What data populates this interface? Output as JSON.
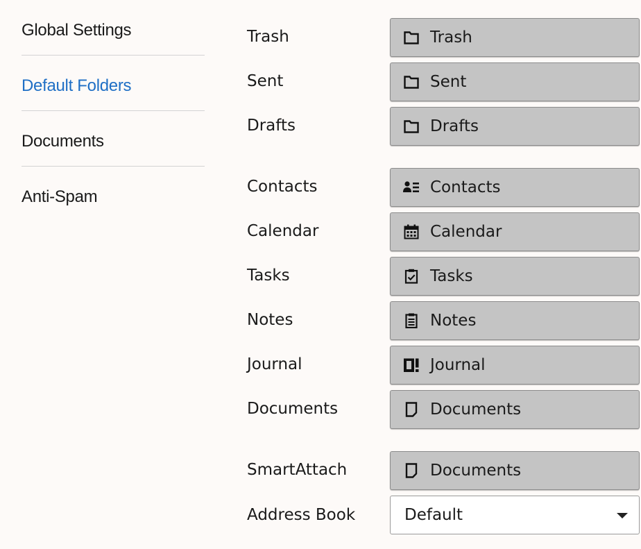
{
  "sidebar": {
    "items": [
      {
        "label": "Global Settings",
        "active": false
      },
      {
        "label": "Default Folders",
        "active": true
      },
      {
        "label": "Documents",
        "active": false
      },
      {
        "label": "Anti-Spam",
        "active": false
      }
    ]
  },
  "folders": {
    "trash": {
      "label": "Trash",
      "value": "Trash",
      "icon": "folder-icon"
    },
    "sent": {
      "label": "Sent",
      "value": "Sent",
      "icon": "folder-icon"
    },
    "drafts": {
      "label": "Drafts",
      "value": "Drafts",
      "icon": "folder-icon"
    },
    "contacts": {
      "label": "Contacts",
      "value": "Contacts",
      "icon": "contacts-icon"
    },
    "calendar": {
      "label": "Calendar",
      "value": "Calendar",
      "icon": "calendar-icon"
    },
    "tasks": {
      "label": "Tasks",
      "value": "Tasks",
      "icon": "tasks-icon"
    },
    "notes": {
      "label": "Notes",
      "value": "Notes",
      "icon": "notes-icon"
    },
    "journal": {
      "label": "Journal",
      "value": "Journal",
      "icon": "journal-icon"
    },
    "documents": {
      "label": "Documents",
      "value": "Documents",
      "icon": "document-icon"
    },
    "smartattach": {
      "label": "SmartAttach",
      "value": "Documents",
      "icon": "document-icon"
    }
  },
  "address_book": {
    "label": "Address Book",
    "value": "Default"
  },
  "colors": {
    "accent": "#1f6fc5",
    "button_bg": "#c4c4c4"
  }
}
